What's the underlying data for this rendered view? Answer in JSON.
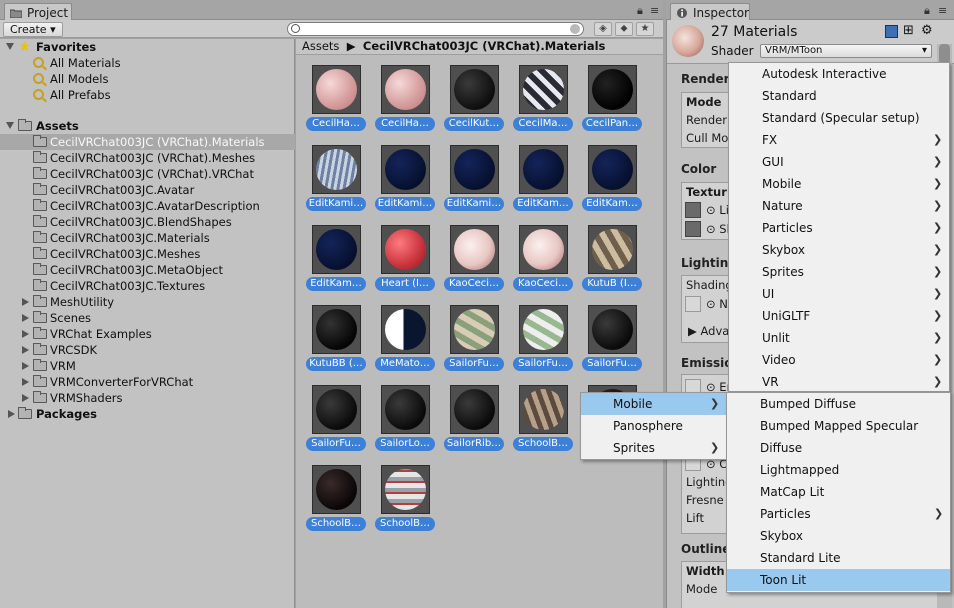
{
  "project": {
    "tab_label": "Project",
    "create_label": "Create",
    "favorites": {
      "label": "Favorites",
      "items": [
        "All Materials",
        "All Models",
        "All Prefabs"
      ]
    },
    "assets": {
      "label": "Assets",
      "items": [
        "CecilVRChat003JC (VRChat).Materials",
        "CecilVRChat003JC (VRChat).Meshes",
        "CecilVRChat003JC (VRChat).VRChat",
        "CecilVRChat003JC.Avatar",
        "CecilVRChat003JC.AvatarDescription",
        "CecilVRChat003JC.BlendShapes",
        "CecilVRChat003JC.Materials",
        "CecilVRChat003JC.Meshes",
        "CecilVRChat003JC.MetaObject",
        "CecilVRChat003JC.Textures",
        "MeshUtility",
        "Scenes",
        "VRChat Examples",
        "VRCSDK",
        "VRM",
        "VRMConverterForVRChat",
        "VRMShaders"
      ],
      "selected": "CecilVRChat003JC (VRChat).Materials"
    },
    "packages_label": "Packages",
    "breadcrumb": {
      "root": "Assets",
      "current": "CecilVRChat003JC (VRChat).Materials"
    },
    "materials": [
      "CecilHa…",
      "CecilHa…",
      "CecilKut…",
      "CecilMa…",
      "CecilPan…",
      "EditKami…",
      "EditKami…",
      "EditKami…",
      "EditKam…",
      "EditKam…",
      "EditKam…",
      "Heart (I…",
      "KaoCeci…",
      "KaoCeci…",
      "KutuB (I…",
      "KutuBB (…",
      "MeMato…",
      "SailorFu…",
      "SailorFu…",
      "SailorFu…",
      "SailorFu…",
      "SailorLo…",
      "SailorRib…",
      "SchoolB…",
      "",
      "SchoolB…",
      "SchoolB…"
    ]
  },
  "inspector": {
    "tab_label": "Inspector",
    "title": "27 Materials",
    "shader_label": "Shader",
    "shader_value": "VRM/MToon",
    "rendering_label": "Render",
    "mode_label": "Mode",
    "render_label": "Render",
    "cull_label": "Cull Mo",
    "color_label": "Color",
    "texture_label": "Textur",
    "lit_label": "Lit",
    "shade_label": "Sh",
    "lighting_label": "Lighting",
    "shading_label": "Shading",
    "no_label": "No",
    "advanced_label": "Adva",
    "emission_label": "Emission",
    "em_label": "Er",
    "c_label": "C",
    "lighting2_label": "Lighting",
    "fresnel_label": "Fresne",
    "lift_label": "Lift",
    "outline_label": "Outline",
    "width_label": "Width",
    "mode2_label": "Mode"
  },
  "shader_menu": {
    "items": [
      {
        "label": "Autodesk Interactive",
        "sub": false
      },
      {
        "label": "Standard",
        "sub": false
      },
      {
        "label": "Standard (Specular setup)",
        "sub": false
      },
      {
        "label": "FX",
        "sub": true
      },
      {
        "label": "GUI",
        "sub": true
      },
      {
        "label": "Mobile",
        "sub": true
      },
      {
        "label": "Nature",
        "sub": true
      },
      {
        "label": "Particles",
        "sub": true
      },
      {
        "label": "Skybox",
        "sub": true
      },
      {
        "label": "Sprites",
        "sub": true
      },
      {
        "label": "UI",
        "sub": true
      },
      {
        "label": "UniGLTF",
        "sub": true
      },
      {
        "label": "Unlit",
        "sub": true
      },
      {
        "label": "Video",
        "sub": true
      },
      {
        "label": "VR",
        "sub": true
      }
    ]
  },
  "legacy_menu": {
    "items": [
      {
        "label": "Mobile",
        "sub": true,
        "highlighted": true
      },
      {
        "label": "Panosphere",
        "sub": false
      },
      {
        "label": "Sprites",
        "sub": true
      }
    ]
  },
  "mobile_menu": {
    "items": [
      {
        "label": "Bumped Diffuse",
        "sub": false
      },
      {
        "label": "Bumped Mapped Specular",
        "sub": false
      },
      {
        "label": "Diffuse",
        "sub": false
      },
      {
        "label": "Lightmapped",
        "sub": false
      },
      {
        "label": "MatCap Lit",
        "sub": false
      },
      {
        "label": "Particles",
        "sub": true
      },
      {
        "label": "Skybox",
        "sub": false
      },
      {
        "label": "Standard Lite",
        "sub": false
      },
      {
        "label": "Toon Lit",
        "sub": false,
        "highlighted": true
      }
    ]
  },
  "colors": {
    "selection_blue": "#3c80d8",
    "menu_highlight": "#99c9ef"
  }
}
